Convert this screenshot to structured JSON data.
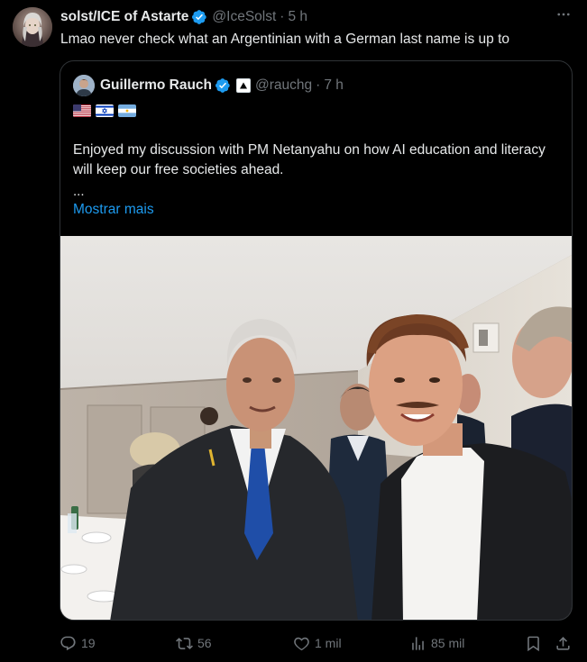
{
  "tweet": {
    "author_name": "solst/ICE of Astarte",
    "handle": "@IceSolst",
    "separator": "·",
    "time": "5 h",
    "text": "Lmao never check what an Argentinian with a German last name is up to",
    "more_icon": "more-horizontal-icon"
  },
  "quote": {
    "author_name": "Guillermo Rauch",
    "handle": "@rauchg",
    "separator": "·",
    "time": "7 h",
    "flags": [
      "us-flag-icon",
      "israel-flag-icon",
      "argentina-flag-icon"
    ],
    "text": "Enjoyed my discussion with PM Netanyahu on how AI education and literacy will keep our free societies ahead.",
    "ellipsis": "...",
    "show_more": "Mostrar mais"
  },
  "actions": {
    "replies": "19",
    "reposts": "56",
    "likes": "1 mil",
    "views": "85 mil"
  },
  "colors": {
    "background": "#000000",
    "text": "#e7e9ea",
    "muted": "#71767b",
    "link": "#1d9bf0",
    "verified": "#1d9bf0",
    "border": "#2f3336"
  }
}
